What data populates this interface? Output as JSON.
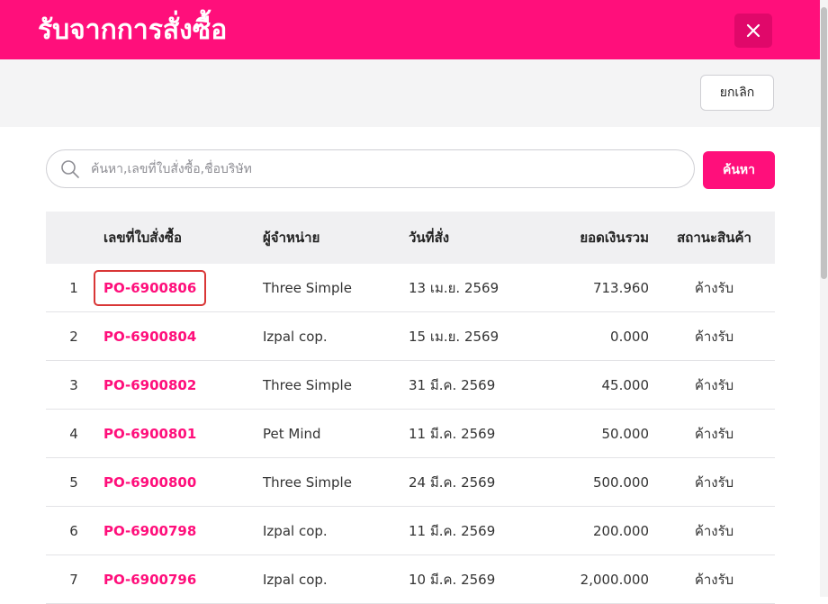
{
  "dialog": {
    "title": "รับจากการสั่งซื้อ",
    "cancel_label": "ยกเลิก"
  },
  "search": {
    "placeholder": "ค้นหา,เลขที่ใบสั่งซื้อ,ชื่อบริษัท",
    "value": "",
    "button_label": "ค้นหา"
  },
  "table": {
    "headers": {
      "po_number": "เลขที่ใบสั่งซื้อ",
      "vendor": "ผู้จำหน่าย",
      "order_date": "วันที่สั่ง",
      "total": "ยอดเงินรวม",
      "status": "สถานะสินค้า"
    },
    "rows": [
      {
        "index": "1",
        "po": "PO-6900806",
        "vendor": "Three Simple",
        "date": "13 เม.ย. 2569",
        "total": "713.960",
        "status": "ค้างรับ"
      },
      {
        "index": "2",
        "po": "PO-6900804",
        "vendor": "Izpal cop.",
        "date": "15 เม.ย. 2569",
        "total": "0.000",
        "status": "ค้างรับ"
      },
      {
        "index": "3",
        "po": "PO-6900802",
        "vendor": "Three Simple",
        "date": "31 มี.ค. 2569",
        "total": "45.000",
        "status": "ค้างรับ"
      },
      {
        "index": "4",
        "po": "PO-6900801",
        "vendor": "Pet Mind",
        "date": "11 มี.ค. 2569",
        "total": "50.000",
        "status": "ค้างรับ"
      },
      {
        "index": "5",
        "po": "PO-6900800",
        "vendor": "Three Simple",
        "date": "24 มี.ค. 2569",
        "total": "500.000",
        "status": "ค้างรับ"
      },
      {
        "index": "6",
        "po": "PO-6900798",
        "vendor": "Izpal cop.",
        "date": "11 มี.ค. 2569",
        "total": "200.000",
        "status": "ค้างรับ"
      },
      {
        "index": "7",
        "po": "PO-6900796",
        "vendor": "Izpal cop.",
        "date": "10 มี.ค. 2569",
        "total": "2,000.000",
        "status": "ค้างรับ"
      }
    ]
  },
  "icons": {
    "close": "close-icon",
    "search": "search-icon"
  },
  "colors": {
    "brand": "#ff0f7b",
    "brand_dark": "#e0086a",
    "highlight": "#d93636"
  }
}
